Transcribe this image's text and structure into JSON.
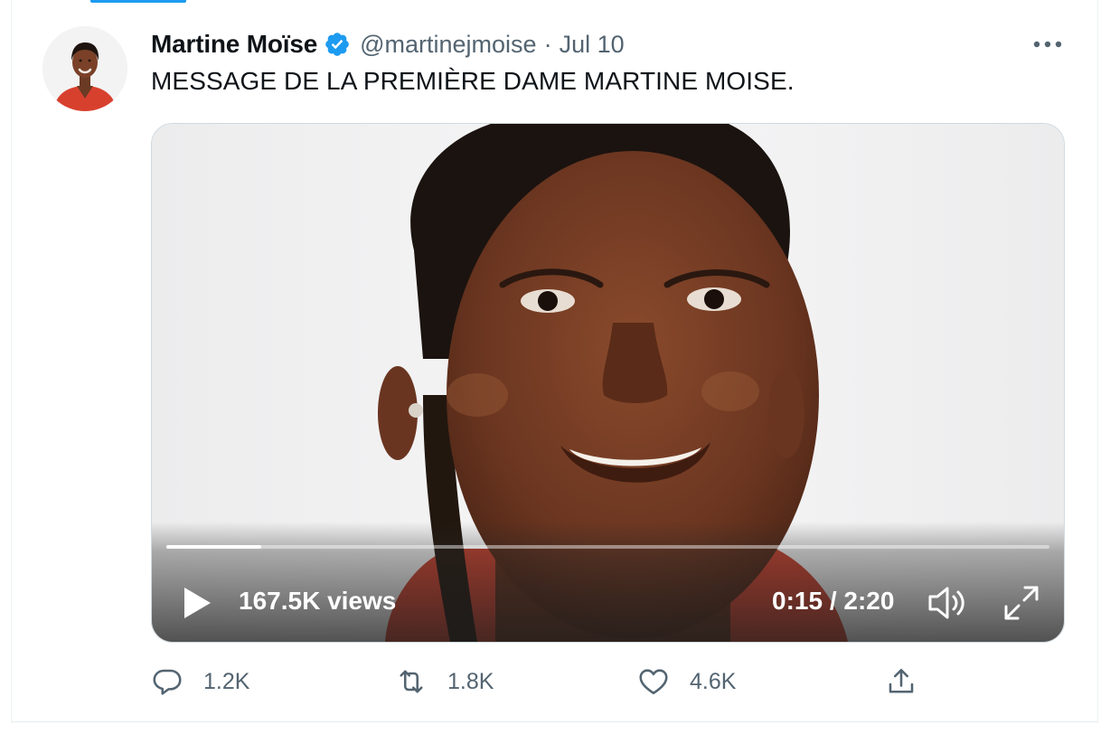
{
  "tweet": {
    "author_name": "Martine Moïse",
    "verified": true,
    "handle": "@martinejmoise",
    "separator": "·",
    "date": "Jul 10",
    "text": "MESSAGE DE LA PREMIÈRE DAME MARTINE MOISE."
  },
  "video": {
    "views": "167.5K views",
    "time": "0:15 / 2:20",
    "progress_fraction": 0.107
  },
  "actions": {
    "replies": "1.2K",
    "retweets": "1.8K",
    "likes": "4.6K"
  },
  "icons": {
    "verified": "verified-badge-icon",
    "more": "more-options-icon",
    "play": "play-icon",
    "volume": "volume-icon",
    "fullscreen": "fullscreen-icon",
    "reply": "reply-icon",
    "retweet": "retweet-icon",
    "like": "heart-icon",
    "share": "share-icon"
  },
  "colors": {
    "brand_blue": "#1d9bf0",
    "text_primary": "#0f1419",
    "text_secondary": "#536471",
    "border": "#cfd9de",
    "shirt_red": "#d8402e"
  }
}
